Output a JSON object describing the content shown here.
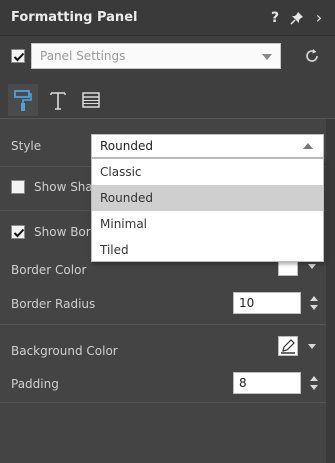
{
  "header": {
    "title": "Formatting Panel",
    "help_glyph": "?",
    "more_glyph": "›"
  },
  "settings": {
    "checked": true,
    "select_value": "Panel Settings"
  },
  "tabs": [
    {
      "icon": "paint-roller-icon",
      "active": true
    },
    {
      "icon": "text-icon",
      "active": false
    },
    {
      "icon": "table-icon",
      "active": false
    }
  ],
  "style": {
    "label": "Style",
    "value": "Rounded",
    "options": [
      "Classic",
      "Rounded",
      "Minimal",
      "Tiled"
    ]
  },
  "show_shadow": {
    "label": "Show Shac",
    "checked": false
  },
  "show_border": {
    "label": "Show Bord",
    "checked": true
  },
  "border_color": {
    "label": "Border Color",
    "color": "#ffffff"
  },
  "border_radius": {
    "label": "Border Radius",
    "value": "10"
  },
  "background_color": {
    "label": "Background Color",
    "color": "#ffffff"
  },
  "padding": {
    "label": "Padding",
    "value": "8"
  },
  "colors": {
    "accent": "#4aa3df",
    "panel": "#444444",
    "header": "#3a3a3a"
  }
}
